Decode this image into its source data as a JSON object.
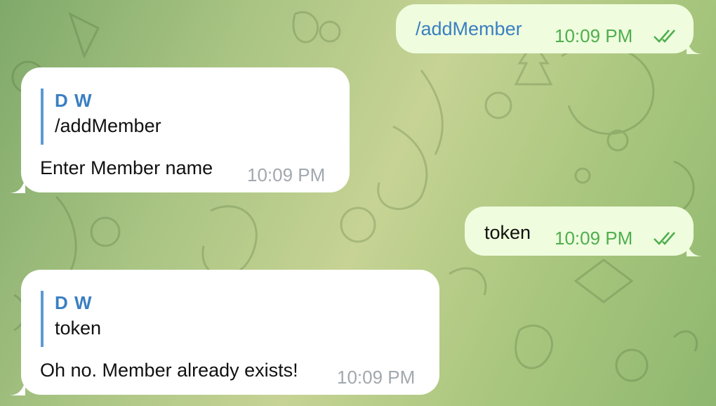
{
  "messages": [
    {
      "id": "m1",
      "direction": "out",
      "text": "/addMember",
      "time": "10:09 PM",
      "status": "read"
    },
    {
      "id": "m2",
      "direction": "in",
      "reply": {
        "author": "D W",
        "text": "/addMember"
      },
      "text": "Enter Member name",
      "time": "10:09 PM"
    },
    {
      "id": "m3",
      "direction": "out",
      "text": "token",
      "time": "10:09 PM",
      "status": "read"
    },
    {
      "id": "m4",
      "direction": "in",
      "reply": {
        "author": "D W",
        "text": "token"
      },
      "text": "Oh no. Member already exists!",
      "time": "10:09 PM"
    }
  ],
  "colors": {
    "outgoing_bubble": "#effdde",
    "incoming_bubble": "#ffffff",
    "link": "#3a7fc1",
    "read_checks": "#4fae4e",
    "quote_bar": "#5c9ad3"
  }
}
